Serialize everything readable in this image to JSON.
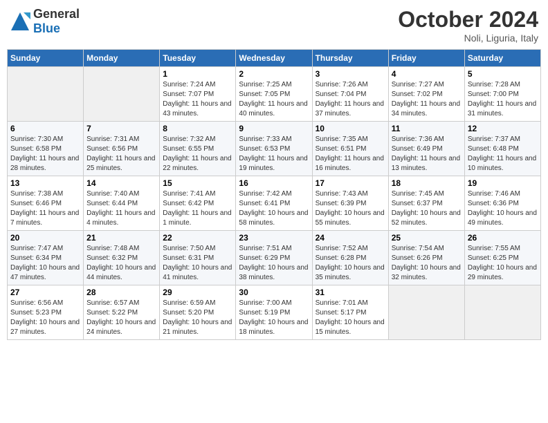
{
  "header": {
    "logo_general": "General",
    "logo_blue": "Blue",
    "title": "October 2024",
    "location": "Noli, Liguria, Italy"
  },
  "calendar": {
    "days_of_week": [
      "Sunday",
      "Monday",
      "Tuesday",
      "Wednesday",
      "Thursday",
      "Friday",
      "Saturday"
    ],
    "weeks": [
      [
        {
          "day": "",
          "sunrise": "",
          "sunset": "",
          "daylight": ""
        },
        {
          "day": "",
          "sunrise": "",
          "sunset": "",
          "daylight": ""
        },
        {
          "day": "1",
          "sunrise": "Sunrise: 7:24 AM",
          "sunset": "Sunset: 7:07 PM",
          "daylight": "Daylight: 11 hours and 43 minutes."
        },
        {
          "day": "2",
          "sunrise": "Sunrise: 7:25 AM",
          "sunset": "Sunset: 7:05 PM",
          "daylight": "Daylight: 11 hours and 40 minutes."
        },
        {
          "day": "3",
          "sunrise": "Sunrise: 7:26 AM",
          "sunset": "Sunset: 7:04 PM",
          "daylight": "Daylight: 11 hours and 37 minutes."
        },
        {
          "day": "4",
          "sunrise": "Sunrise: 7:27 AM",
          "sunset": "Sunset: 7:02 PM",
          "daylight": "Daylight: 11 hours and 34 minutes."
        },
        {
          "day": "5",
          "sunrise": "Sunrise: 7:28 AM",
          "sunset": "Sunset: 7:00 PM",
          "daylight": "Daylight: 11 hours and 31 minutes."
        }
      ],
      [
        {
          "day": "6",
          "sunrise": "Sunrise: 7:30 AM",
          "sunset": "Sunset: 6:58 PM",
          "daylight": "Daylight: 11 hours and 28 minutes."
        },
        {
          "day": "7",
          "sunrise": "Sunrise: 7:31 AM",
          "sunset": "Sunset: 6:56 PM",
          "daylight": "Daylight: 11 hours and 25 minutes."
        },
        {
          "day": "8",
          "sunrise": "Sunrise: 7:32 AM",
          "sunset": "Sunset: 6:55 PM",
          "daylight": "Daylight: 11 hours and 22 minutes."
        },
        {
          "day": "9",
          "sunrise": "Sunrise: 7:33 AM",
          "sunset": "Sunset: 6:53 PM",
          "daylight": "Daylight: 11 hours and 19 minutes."
        },
        {
          "day": "10",
          "sunrise": "Sunrise: 7:35 AM",
          "sunset": "Sunset: 6:51 PM",
          "daylight": "Daylight: 11 hours and 16 minutes."
        },
        {
          "day": "11",
          "sunrise": "Sunrise: 7:36 AM",
          "sunset": "Sunset: 6:49 PM",
          "daylight": "Daylight: 11 hours and 13 minutes."
        },
        {
          "day": "12",
          "sunrise": "Sunrise: 7:37 AM",
          "sunset": "Sunset: 6:48 PM",
          "daylight": "Daylight: 11 hours and 10 minutes."
        }
      ],
      [
        {
          "day": "13",
          "sunrise": "Sunrise: 7:38 AM",
          "sunset": "Sunset: 6:46 PM",
          "daylight": "Daylight: 11 hours and 7 minutes."
        },
        {
          "day": "14",
          "sunrise": "Sunrise: 7:40 AM",
          "sunset": "Sunset: 6:44 PM",
          "daylight": "Daylight: 11 hours and 4 minutes."
        },
        {
          "day": "15",
          "sunrise": "Sunrise: 7:41 AM",
          "sunset": "Sunset: 6:42 PM",
          "daylight": "Daylight: 11 hours and 1 minute."
        },
        {
          "day": "16",
          "sunrise": "Sunrise: 7:42 AM",
          "sunset": "Sunset: 6:41 PM",
          "daylight": "Daylight: 10 hours and 58 minutes."
        },
        {
          "day": "17",
          "sunrise": "Sunrise: 7:43 AM",
          "sunset": "Sunset: 6:39 PM",
          "daylight": "Daylight: 10 hours and 55 minutes."
        },
        {
          "day": "18",
          "sunrise": "Sunrise: 7:45 AM",
          "sunset": "Sunset: 6:37 PM",
          "daylight": "Daylight: 10 hours and 52 minutes."
        },
        {
          "day": "19",
          "sunrise": "Sunrise: 7:46 AM",
          "sunset": "Sunset: 6:36 PM",
          "daylight": "Daylight: 10 hours and 49 minutes."
        }
      ],
      [
        {
          "day": "20",
          "sunrise": "Sunrise: 7:47 AM",
          "sunset": "Sunset: 6:34 PM",
          "daylight": "Daylight: 10 hours and 47 minutes."
        },
        {
          "day": "21",
          "sunrise": "Sunrise: 7:48 AM",
          "sunset": "Sunset: 6:32 PM",
          "daylight": "Daylight: 10 hours and 44 minutes."
        },
        {
          "day": "22",
          "sunrise": "Sunrise: 7:50 AM",
          "sunset": "Sunset: 6:31 PM",
          "daylight": "Daylight: 10 hours and 41 minutes."
        },
        {
          "day": "23",
          "sunrise": "Sunrise: 7:51 AM",
          "sunset": "Sunset: 6:29 PM",
          "daylight": "Daylight: 10 hours and 38 minutes."
        },
        {
          "day": "24",
          "sunrise": "Sunrise: 7:52 AM",
          "sunset": "Sunset: 6:28 PM",
          "daylight": "Daylight: 10 hours and 35 minutes."
        },
        {
          "day": "25",
          "sunrise": "Sunrise: 7:54 AM",
          "sunset": "Sunset: 6:26 PM",
          "daylight": "Daylight: 10 hours and 32 minutes."
        },
        {
          "day": "26",
          "sunrise": "Sunrise: 7:55 AM",
          "sunset": "Sunset: 6:25 PM",
          "daylight": "Daylight: 10 hours and 29 minutes."
        }
      ],
      [
        {
          "day": "27",
          "sunrise": "Sunrise: 6:56 AM",
          "sunset": "Sunset: 5:23 PM",
          "daylight": "Daylight: 10 hours and 27 minutes."
        },
        {
          "day": "28",
          "sunrise": "Sunrise: 6:57 AM",
          "sunset": "Sunset: 5:22 PM",
          "daylight": "Daylight: 10 hours and 24 minutes."
        },
        {
          "day": "29",
          "sunrise": "Sunrise: 6:59 AM",
          "sunset": "Sunset: 5:20 PM",
          "daylight": "Daylight: 10 hours and 21 minutes."
        },
        {
          "day": "30",
          "sunrise": "Sunrise: 7:00 AM",
          "sunset": "Sunset: 5:19 PM",
          "daylight": "Daylight: 10 hours and 18 minutes."
        },
        {
          "day": "31",
          "sunrise": "Sunrise: 7:01 AM",
          "sunset": "Sunset: 5:17 PM",
          "daylight": "Daylight: 10 hours and 15 minutes."
        },
        {
          "day": "",
          "sunrise": "",
          "sunset": "",
          "daylight": ""
        },
        {
          "day": "",
          "sunrise": "",
          "sunset": "",
          "daylight": ""
        }
      ]
    ]
  }
}
